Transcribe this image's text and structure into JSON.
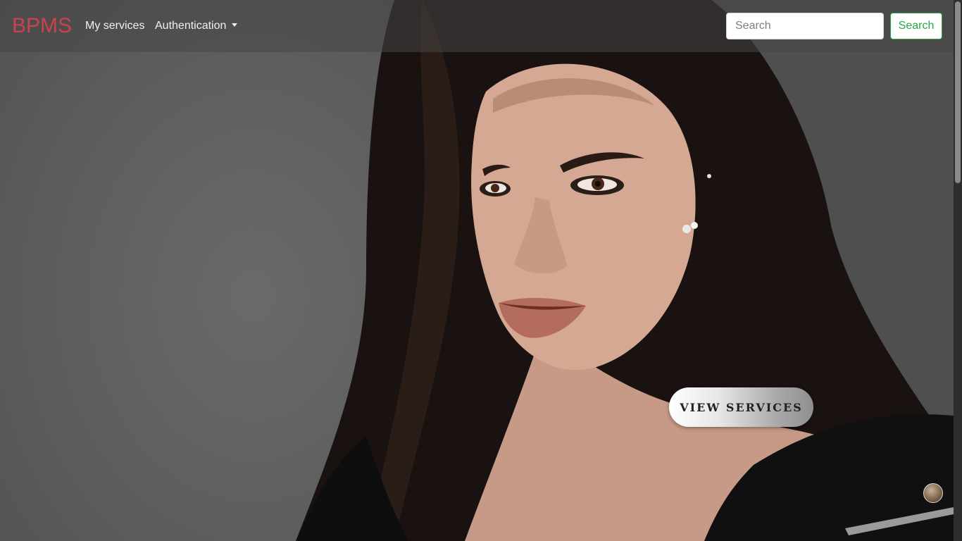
{
  "navbar": {
    "brand": "BPMS",
    "links": {
      "services": "My services",
      "authentication": "Authentication"
    },
    "search": {
      "placeholder": "Search",
      "value": "",
      "button_label": "Search"
    }
  },
  "hero": {
    "cta_label": "VIEW SERVICES"
  },
  "colors": {
    "brand": "#c9434f",
    "search_button": "#28a745"
  },
  "icons": {
    "auth_dropdown": "caret-down-icon",
    "scroll": "scroll-top-icon"
  }
}
